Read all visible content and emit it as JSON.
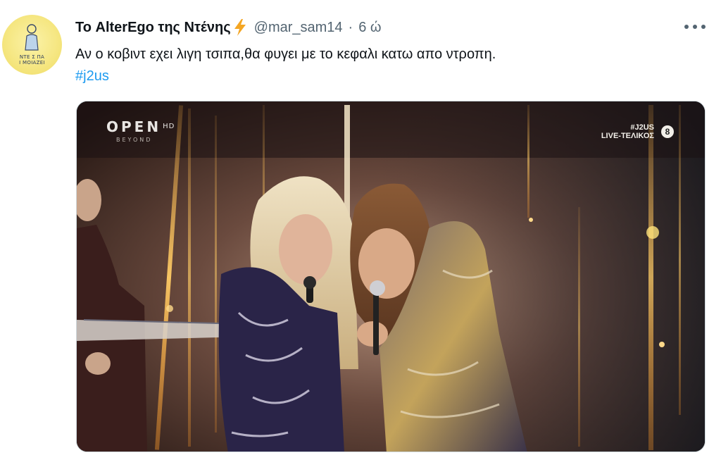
{
  "tweet": {
    "author_name": "Το AlterEgo της Ντένης",
    "handle": "@mar_sam14",
    "separator": "·",
    "time": "6 ώ",
    "text": "Αν ο κοβιντ εχει λιγη τσιπα,θα φυγει με το κεφαλι κατω απο ντροπη.",
    "hashtag": "#j2us",
    "more_icon": "more-dots-icon",
    "badge_icon": "lightning-bolt-icon"
  },
  "media": {
    "channel_logo": "OPEN",
    "channel_logo_suffix": "HD",
    "channel_sub": "BEYOND",
    "show_tag": "#J2US",
    "live_label": "LIVE-ΤΕΛΙΚΟΣ",
    "rating_badge": "8"
  },
  "colors": {
    "link": "#1d9bf0",
    "secondary_text": "#536471",
    "bolt": "#f4a623"
  }
}
